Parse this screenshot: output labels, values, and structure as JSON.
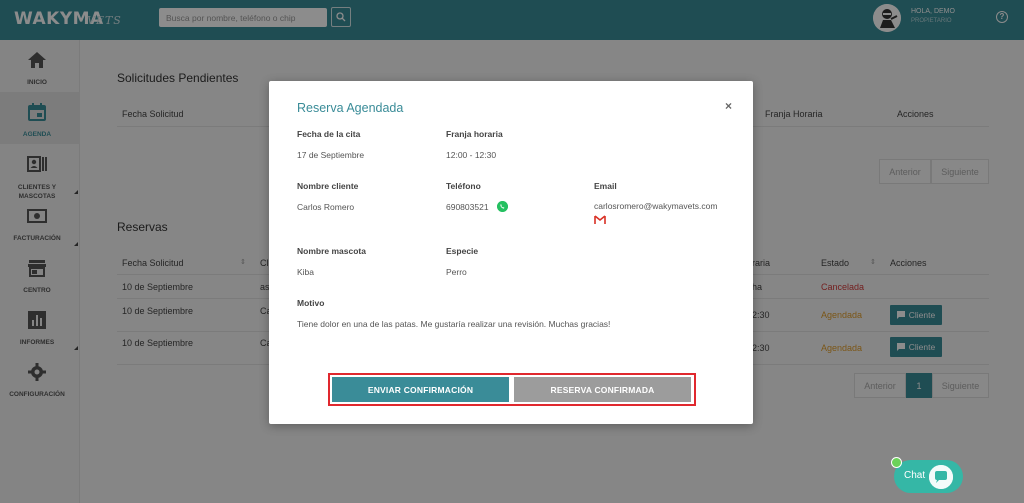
{
  "header": {
    "logo": "WAKYMA",
    "logo_sub": "VETS",
    "search_placeholder": "Busca por nombre, teléfono o chip",
    "user_greeting": "HOLA, DEMO",
    "user_role": "PROPIETARIO",
    "help": "?"
  },
  "sidebar": {
    "items": [
      {
        "label": "INICIO",
        "icon": "home-icon"
      },
      {
        "label": "AGENDA",
        "icon": "calendar-icon"
      },
      {
        "label": "CLIENTES Y MASCOTAS",
        "icon": "id-card-icon"
      },
      {
        "label": "FACTURACIÓN",
        "icon": "money-icon"
      },
      {
        "label": "CENTRO",
        "icon": "store-icon"
      },
      {
        "label": "INFORMES",
        "icon": "chart-icon"
      },
      {
        "label": "CONFIGURACIÓN",
        "icon": "gear-icon"
      }
    ]
  },
  "solicitudes": {
    "title": "Solicitudes Pendientes",
    "headers": [
      "Fecha Solicitud",
      "Franja Horaria",
      "Acciones"
    ],
    "prev": "Anterior",
    "next": "Siguiente"
  },
  "reservas": {
    "title": "Reservas",
    "headers": [
      "Fecha Solicitud",
      "Cl",
      "raria",
      "Estado",
      "Acciones"
    ],
    "rows": [
      {
        "fecha": "10 de Septiembre",
        "cl": "as",
        "franja": "ha",
        "estado": "Cancelada"
      },
      {
        "fecha": "10 de Septiembre",
        "cl": "Ca",
        "franja": "2:30",
        "estado": "Agendada",
        "accion": "Cliente"
      },
      {
        "fecha": "10 de Septiembre",
        "cl": "Ca",
        "franja": "2:30",
        "estado": "Agendada",
        "accion": "Cliente"
      }
    ],
    "prev": "Anterior",
    "page": "1",
    "next": "Siguiente"
  },
  "modal": {
    "title": "Reserva Agendada",
    "close": "×",
    "fields": {
      "fecha_label": "Fecha de la cita",
      "fecha_value": "17 de Septiembre",
      "franja_label": "Franja horaria",
      "franja_value": "12:00 - 12:30",
      "cliente_label": "Nombre cliente",
      "cliente_value": "Carlos Romero",
      "telefono_label": "Teléfono",
      "telefono_value": "690803521",
      "email_label": "Email",
      "email_value": "carlosromero@wakymavets.com",
      "mascota_label": "Nombre mascota",
      "mascota_value": "Kiba",
      "especie_label": "Especie",
      "especie_value": "Perro",
      "motivo_label": "Motivo",
      "motivo_value": "Tiene dolor en una de las patas. Me gustaría realizar una revisión. Muchas gracias!"
    },
    "btn_send": "ENVIAR CONFIRMACIÓN",
    "btn_confirmed": "RESERVA CONFIRMADA"
  },
  "chat": {
    "label": "Chat"
  },
  "colors": {
    "brand": "#3a8c98",
    "cancel": "#d23b3b",
    "pending": "#e09d2b",
    "highlight": "#e0282e"
  }
}
